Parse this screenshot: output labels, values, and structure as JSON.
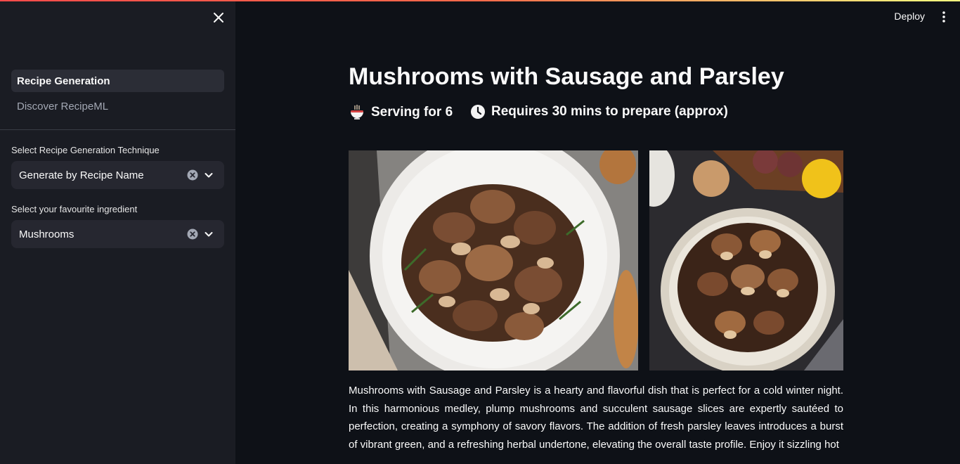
{
  "sidebar": {
    "nav": [
      {
        "label": "Recipe Generation",
        "active": true
      },
      {
        "label": "Discover RecipeML",
        "active": false
      }
    ],
    "technique": {
      "label": "Select Recipe Generation Technique",
      "value": "Generate by Recipe Name"
    },
    "ingredient": {
      "label": "Select your favourite ingredient",
      "value": "Mushrooms"
    }
  },
  "header": {
    "deploy_label": "Deploy"
  },
  "recipe": {
    "title": "Mushrooms with Sausage and Parsley",
    "serving": "Serving for 6",
    "time": "Requires 30 mins to prepare (approx)",
    "description": "Mushrooms with Sausage and Parsley is a hearty and flavorful dish that is perfect for a cold winter night. In this harmonious medley, plump mushrooms and succulent sausage slices are expertly sautéed to perfection, creating a symphony of savory flavors. The addition of fresh parsley leaves introduces a burst of vibrant green, and a refreshing herbal undertone, elevating the overall taste profile. Enjoy it sizzling hot"
  },
  "icons": {
    "serving": "bowl-icon",
    "time": "clock-icon"
  },
  "colors": {
    "background": "#0e1117",
    "sidebar": "#1a1c23",
    "select": "#262730",
    "accent": "#ff4b4b"
  }
}
